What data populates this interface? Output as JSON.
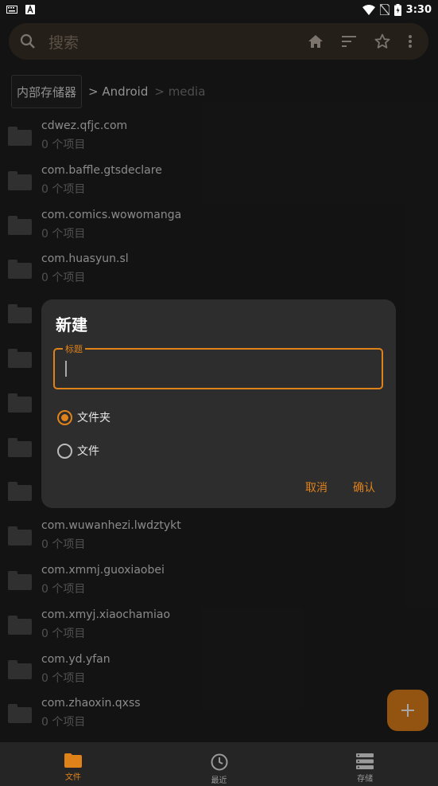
{
  "status_bar": {
    "time": "3:30",
    "icons": [
      "keyboard-icon",
      "a-badge-icon",
      "wifi-icon",
      "no-sim-icon",
      "battery-charging-icon"
    ]
  },
  "search": {
    "placeholder": "搜索",
    "actions": [
      "home-icon",
      "sort-icon",
      "star-icon",
      "more-vert-icon"
    ]
  },
  "breadcrumb": {
    "items": [
      "内部存储器",
      "> Android",
      "> media"
    ]
  },
  "files": [
    {
      "name": "cdwez.qfjc.com",
      "sub": "0 个项目"
    },
    {
      "name": "com.baffle.gtsdeclare",
      "sub": "0 个项目"
    },
    {
      "name": "com.comics.wowomanga",
      "sub": "0 个项目"
    },
    {
      "name": "com.huasyun.sl",
      "sub": "0 个项目"
    },
    {
      "name": "",
      "sub": ""
    },
    {
      "name": "",
      "sub": ""
    },
    {
      "name": "",
      "sub": ""
    },
    {
      "name": "",
      "sub": ""
    },
    {
      "name": "",
      "sub": ""
    },
    {
      "name": "com.wuwanhezi.lwdztykt",
      "sub": "0 个项目"
    },
    {
      "name": "com.xmmj.guoxiaobei",
      "sub": "0 个项目"
    },
    {
      "name": "com.xmyj.xiaochamiao",
      "sub": "0 个项目"
    },
    {
      "name": "com.yd.yfan",
      "sub": "0 个项目"
    },
    {
      "name": "com.zhaoxin.qxss",
      "sub": "0 个项目"
    }
  ],
  "dialog": {
    "title": "新建",
    "field_label": "标题",
    "field_value": "",
    "options": [
      {
        "label": "文件夹",
        "selected": true
      },
      {
        "label": "文件",
        "selected": false
      }
    ],
    "cancel": "取消",
    "confirm": "确认"
  },
  "fab": {
    "icon": "plus-icon"
  },
  "bottom_nav": [
    {
      "label": "文件",
      "icon": "folder-icon",
      "active": true
    },
    {
      "label": "最近",
      "icon": "clock-icon",
      "active": false
    },
    {
      "label": "存储",
      "icon": "storage-icon",
      "active": false
    }
  ],
  "colors": {
    "accent": "#e0821a",
    "background": "#1e1e1e",
    "dialog": "#2d2d2d"
  }
}
